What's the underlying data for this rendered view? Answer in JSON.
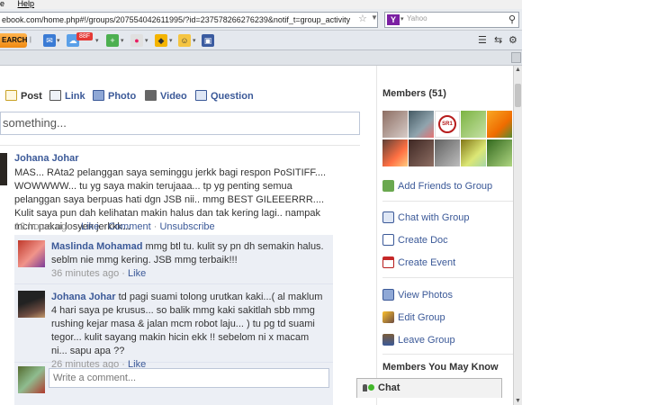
{
  "browser": {
    "menu_items": [
      "e",
      "Help"
    ],
    "url": "ebook.com/home.php#!/groups/207554042611995/?id=237578266276239&notif_t=group_activity",
    "search_placeholder": "Yahoo",
    "search_engine_icon": "yahoo-icon",
    "toolbar_search_label": "EARCH",
    "toolbar_badge": "88F"
  },
  "composer": {
    "tabs": [
      {
        "label": "Post",
        "icon": "post-icon"
      },
      {
        "label": "Link",
        "icon": "link-icon"
      },
      {
        "label": "Photo",
        "icon": "photo-icon"
      },
      {
        "label": "Video",
        "icon": "video-icon"
      },
      {
        "label": "Question",
        "icon": "question-icon"
      }
    ],
    "placeholder": "something..."
  },
  "post": {
    "author": "Johana Johar",
    "text": "MAS... RAta2 pelanggan saya seminggu jerkk bagi respon PoSITIFF.... WOWWWW... tu yg saya makin terujaaa... tp yg penting semua pelanggan saya berpuas hati dgn JSB nii.. mmg BEST GILEEERRR.... Kulit saya pun dah kelihatan makin halus dan tak kering lagi.. nampak mcm pakai losyen jerkkk...",
    "time": "12 hours ago",
    "sep": "·",
    "like": "Like",
    "comment": "Comment",
    "unsubscribe": "Unsubscribe"
  },
  "comments": [
    {
      "author": "Maslinda Mohamad",
      "text": "mmg btl tu. kulit sy pn dh semakin halus. seblm nie mmg kering. JSB mmg terbaik!!!",
      "time": "36 minutes ago",
      "like": "Like"
    },
    {
      "author": "Johana Johar",
      "text": "td pagi suami tolong urutkan kaki...( al maklum 4 hari saya pe krusus... so balik mmg kaki sakitlah sbb mmg rushing kejar masa & jalan mcm robot laju... ) tu pg td suami tegor... kulit sayang makin hicin ekk !! sebelom ni x macam ni... sapu apa ??",
      "time": "26 minutes ago",
      "like": "Like"
    }
  ],
  "comment_placeholder": "Write a comment...",
  "sidebar": {
    "members_title": "Members (51)",
    "links": [
      {
        "label": "Add Friends to Group",
        "icon": "add-friends-icon"
      },
      {
        "label": "Chat with Group",
        "icon": "chat-icon"
      },
      {
        "label": "Create Doc",
        "icon": "doc-icon"
      },
      {
        "label": "Create Event",
        "icon": "calendar-icon"
      },
      {
        "label": "View Photos",
        "icon": "photos-icon"
      },
      {
        "label": "Edit Group",
        "icon": "pencil-icon"
      },
      {
        "label": "Leave Group",
        "icon": "leave-icon"
      }
    ],
    "mymk_title": "Members You May Know",
    "seal_text": "SR1"
  },
  "chat": {
    "label": "Chat"
  }
}
